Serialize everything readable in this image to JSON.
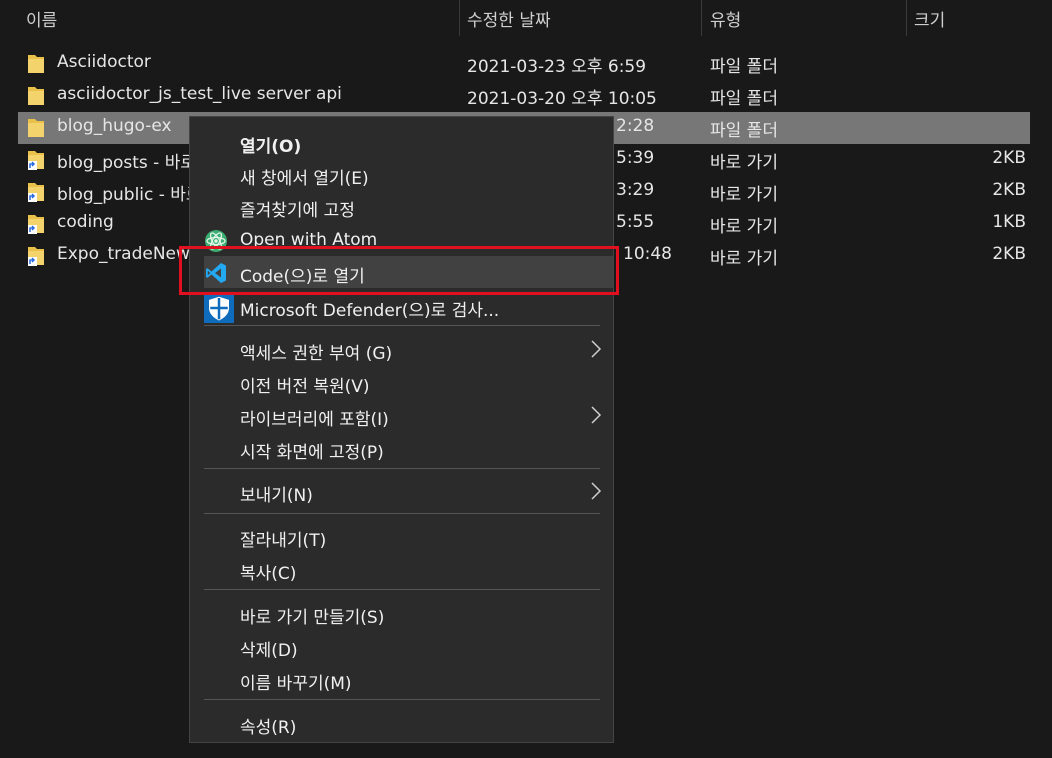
{
  "columns": {
    "name": "이름",
    "date": "수정한 날짜",
    "type": "유형",
    "size": "크기"
  },
  "files": [
    {
      "name": "Asciidoctor",
      "date": "2021-03-23 오후 6:59",
      "type": "파일 폴더",
      "size": "",
      "icon": "folder-icon"
    },
    {
      "name": "asciidoctor_js_test_live server api",
      "date": "2021-03-20 오후 10:05",
      "type": "파일 폴더",
      "size": "",
      "icon": "folder-icon"
    },
    {
      "name": "blog_hugo-ex",
      "date": "2:28",
      "type": "파일 폴더",
      "size": "",
      "icon": "folder-icon",
      "selected": true
    },
    {
      "name": "blog_posts - 바로",
      "date": "5:39",
      "type": "바로 가기",
      "size": "2KB",
      "icon": "folder-shortcut-icon"
    },
    {
      "name": "blog_public - 바로",
      "date": "3:29",
      "type": "바로 가기",
      "size": "2KB",
      "icon": "folder-shortcut-icon"
    },
    {
      "name": "coding",
      "date": "5:55",
      "type": "바로 가기",
      "size": "1KB",
      "icon": "folder-shortcut-icon"
    },
    {
      "name": "Expo_tradeNews",
      "date": "10:48",
      "type": "바로 가기",
      "size": "2KB",
      "icon": "folder-shortcut-icon"
    }
  ],
  "context_menu": {
    "open": "열기(O)",
    "open_new_window": "새 창에서 열기(E)",
    "pin_quick_access": "즐겨찾기에 고정",
    "open_with_atom": "Open with Atom",
    "open_with_code": "Code(으)로 열기",
    "defender_scan": "Microsoft Defender(으)로 검사...",
    "give_access": "액세스 권한 부여 (G)",
    "restore_previous": "이전 버전 복원(V)",
    "include_library": "라이브러리에 포함(I)",
    "pin_start": "시작 화면에 고정(P)",
    "send_to": "보내기(N)",
    "cut": "잘라내기(T)",
    "copy": "복사(C)",
    "create_shortcut": "바로 가기 만들기(S)",
    "delete": "삭제(D)",
    "rename": "이름 바꾸기(M)",
    "properties": "속성(R)"
  },
  "colors": {
    "background": "#191919",
    "selected_row": "#777777",
    "menu_bg": "#2b2b2b",
    "highlight": "#414141",
    "red_box": "#e01020",
    "vscode_blue": "#23a9f2"
  }
}
